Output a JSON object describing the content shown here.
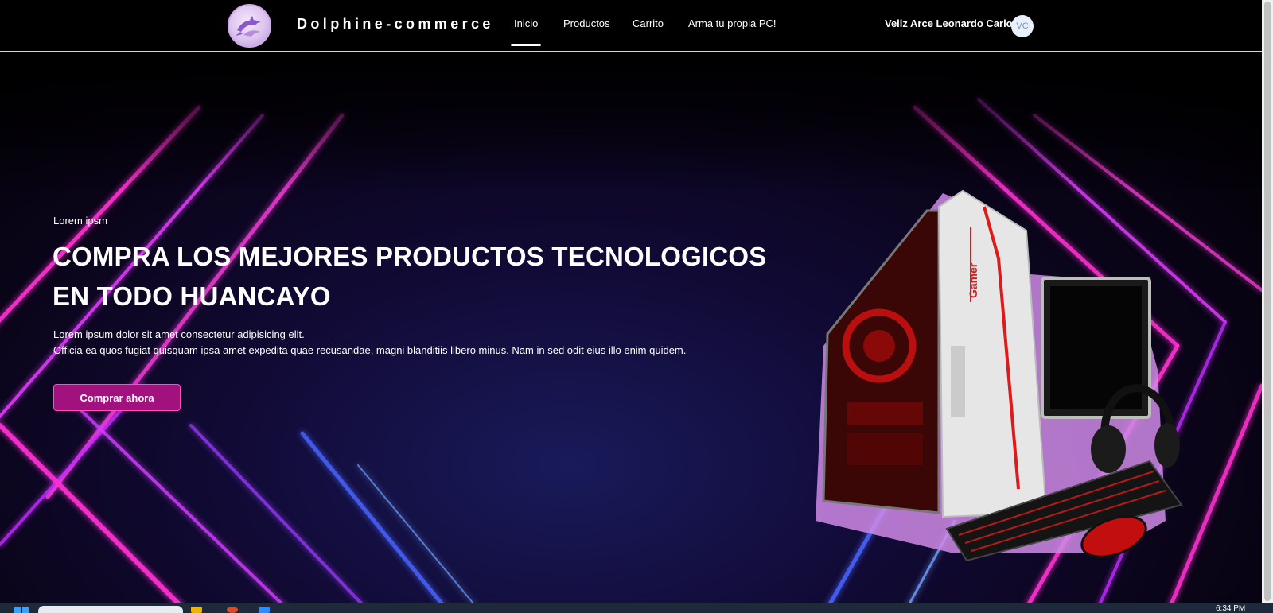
{
  "navbar": {
    "brand": "Dolphine-commerce",
    "links": [
      {
        "label": "Inicio",
        "active": true
      },
      {
        "label": "Productos",
        "active": false
      },
      {
        "label": "Carrito",
        "active": false
      },
      {
        "label": "Arma tu propia PC!",
        "active": false
      }
    ],
    "user_name": "Veliz Arce Leonardo Carlos",
    "avatar_initials": "VC",
    "logo_icon": "dolphin-logo-icon"
  },
  "hero": {
    "kicker": "Lorem ipsm",
    "title_line1": "COMPRA LOS MEJORES PRODUCTOS TECNOLOGICOS",
    "title_line2": "EN TODO HUANCAYO",
    "desc_line1": "Lorem ipsum dolor sit amet consectetur adipisicing elit.",
    "desc_line2": "Officia ea quos fugiat quisquam ipsa amet expedita quae recusandae, magni blanditiis libero minus. Nam in sed odit eius illo enim quidem.",
    "cta_label": "Comprar ahora",
    "image_label": "Gamer"
  },
  "taskbar": {
    "clock": "6:34 PM"
  },
  "colors": {
    "accent": "#a1127f",
    "neon_pink": "#ff2fd1",
    "neon_blue": "#3b5bff",
    "background": "#000000"
  }
}
